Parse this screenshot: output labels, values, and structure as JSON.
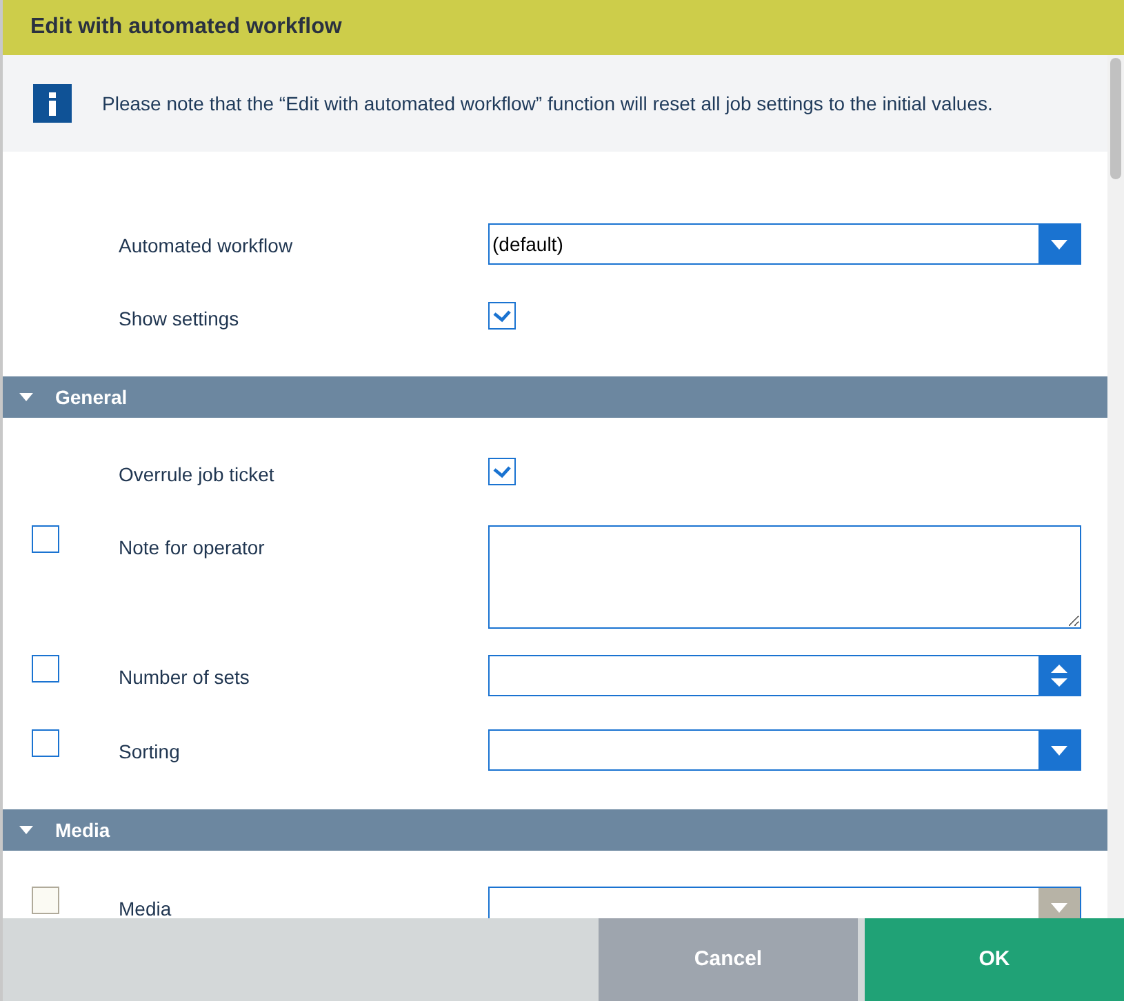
{
  "window": {
    "title": "Edit with automated workflow"
  },
  "notice": {
    "text": "Please note that the “Edit with automated workflow” function will reset all job settings to the initial values."
  },
  "top_fields": [
    {
      "kind": "select",
      "label": "Automated workflow",
      "value": "(default)"
    },
    {
      "kind": "checkbox",
      "label": "Show settings",
      "checked": true
    }
  ],
  "sections": [
    {
      "title": "General",
      "expanded": true,
      "fields": [
        {
          "kind": "checkbox",
          "label": "Overrule job ticket",
          "checked": true
        },
        {
          "kind": "textarea",
          "label": "Note for operator",
          "include": false
        },
        {
          "kind": "number",
          "label": "Number of sets",
          "include": false
        },
        {
          "kind": "select",
          "label": "Sorting",
          "include": false,
          "disabled": false
        }
      ]
    },
    {
      "title": "Media",
      "expanded": true,
      "fields": [
        {
          "kind": "select",
          "label": "Media",
          "include": false,
          "disabled": true
        }
      ]
    }
  ],
  "buttons": [
    {
      "kind": "cancel",
      "label": "Cancel"
    },
    {
      "kind": "ok",
      "label": "OK"
    }
  ]
}
